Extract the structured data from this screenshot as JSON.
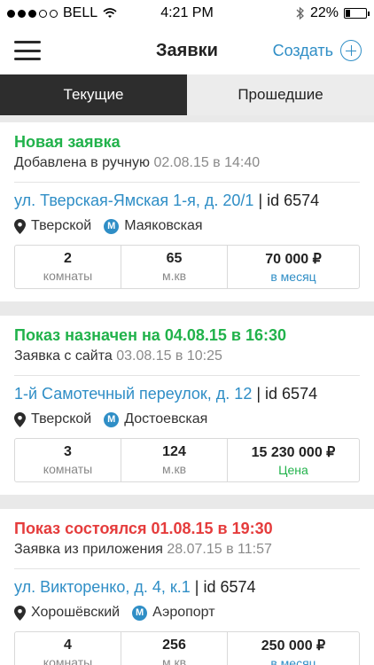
{
  "status_bar": {
    "carrier": "BELL",
    "time": "4:21 PM",
    "battery": "22%",
    "battery_level": 0.22
  },
  "nav": {
    "title": "Заявки",
    "create_label": "Создать"
  },
  "tabs": [
    {
      "label": "Текущие"
    },
    {
      "label": "Прошедшие"
    }
  ],
  "colors": {
    "green": "#21b24b",
    "red": "#e53c3c",
    "blue": "#2f8ec6"
  },
  "cards": [
    {
      "status": "Новая заявка",
      "status_color": "green",
      "source": "Добавлена в ручную",
      "source_date": "02.08.15 в 14:40",
      "address": "ул. Тверская-Ямская 1-я, д. 20/1",
      "id": "| id 6574",
      "district": "Тверской",
      "metro": "Маяковская",
      "rooms": "2",
      "rooms_label": "комнаты",
      "area": "65",
      "area_label": "м.кв",
      "price": "70 000 ₽",
      "price_label": "в месяц",
      "price_label_color": "blue"
    },
    {
      "status": "Показ назначен на 04.08.15 в 16:30",
      "status_color": "green",
      "source": "Заявка с сайта",
      "source_date": "03.08.15 в 10:25",
      "address": "1-й Самотечный переулок, д. 12",
      "id": "| id 6574",
      "district": "Тверской",
      "metro": "Достоевская",
      "rooms": "3",
      "rooms_label": "комнаты",
      "area": "124",
      "area_label": "м.кв",
      "price": "15 230 000 ₽",
      "price_label": "Цена",
      "price_label_color": "green"
    },
    {
      "status": "Показ состоялся 01.08.15 в 19:30",
      "status_color": "red",
      "source": "Заявка из приложения",
      "source_date": "28.07.15 в 11:57",
      "address": "ул. Викторенко, д. 4, к.1",
      "id": "| id 6574",
      "district": "Хорошёвский",
      "metro": "Аэропорт",
      "rooms": "4",
      "rooms_label": "комнаты",
      "area": "256",
      "area_label": "м.кв",
      "price": "250 000 ₽",
      "price_label": "в месяц",
      "price_label_color": "blue"
    }
  ]
}
